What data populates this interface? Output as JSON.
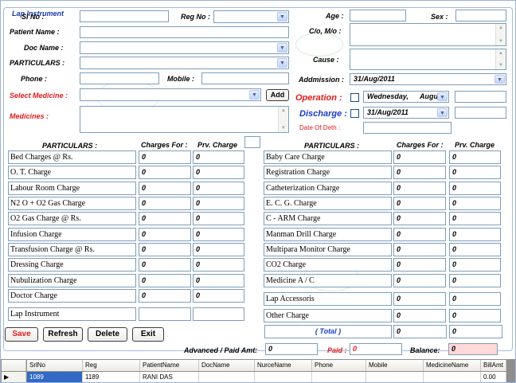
{
  "form": {
    "group_title": "Lap Instrument",
    "sl_no_label": "Sl No :",
    "reg_no_label": "Reg No :",
    "age_label": "Age :",
    "sex_label": "Sex :",
    "patient_name_label": "Patient Name :",
    "co_mo_label": "C/o, M/o :",
    "doc_name_label": "Doc Name :",
    "particulars_label": "PARTICULARS :",
    "cause_label": "Cause :",
    "phone_label": "Phone :",
    "mobile_label": "Mobile :",
    "admission_label": "Addmission :",
    "admission_date": "31/Aug/2011",
    "select_medicine_label": "Select Medicine :",
    "add_button": "Add",
    "operation_label": "Operation :",
    "operation_day": "Wednesday,",
    "operation_month": "Augu",
    "discharge_label": "Discharge :",
    "discharge_date": "31/Aug/2011",
    "date_of_death_label": "Date Of Deth :",
    "medicines_label": "Medicines :"
  },
  "charges": {
    "left_header": "PARTICULARS :",
    "charges_for_header": "Charges For :",
    "prev_charge_header": "Prv. Charge",
    "right_header": "PARTICULARS :",
    "right_charges_for_header": "Charges For :",
    "right_prev_charge_header": "Prv. Charge",
    "left_items": [
      {
        "label": "Bed Charges @ Rs.",
        "charge": "0",
        "prev": "0"
      },
      {
        "label": "O. T. Charge",
        "charge": "0",
        "prev": "0"
      },
      {
        "label": "Labour Room Charge",
        "charge": "0",
        "prev": "0"
      },
      {
        "label": "N2 O + O2  Gas Charge",
        "charge": "0",
        "prev": "0"
      },
      {
        "label": "O2  Gas Charge @ Rs.",
        "charge": "0",
        "prev": "0"
      },
      {
        "label": "Infusion Charge",
        "charge": "0",
        "prev": "0"
      },
      {
        "label": "Transfusion Charge @ Rs.",
        "charge": "0",
        "prev": "0"
      },
      {
        "label": "Dressing Charge",
        "charge": "0",
        "prev": "0"
      },
      {
        "label": "Nubulization Charge",
        "charge": "0",
        "prev": "0"
      },
      {
        "label": "Doctor Charge",
        "charge": "0",
        "prev": "0"
      },
      {
        "label": "Lap Instrument",
        "charge": "",
        "prev": ""
      }
    ],
    "right_items": [
      {
        "label": "Baby Care Charge",
        "charge": "0",
        "prev": "0"
      },
      {
        "label": "Registration Charge",
        "charge": "0",
        "prev": "0"
      },
      {
        "label": "Catheterization Charge",
        "charge": "0",
        "prev": "0"
      },
      {
        "label": "E. C. G. Charge",
        "charge": "0",
        "prev": "0"
      },
      {
        "label": "C - ARM Charge",
        "charge": "0",
        "prev": "0"
      },
      {
        "label": "Manman Drill Charge",
        "charge": "0",
        "prev": "0"
      },
      {
        "label": "Multipara Monitor Charge",
        "charge": "0",
        "prev": "0"
      },
      {
        "label": "CO2  Charge",
        "charge": "0",
        "prev": "0"
      },
      {
        "label": "Medicine A / C",
        "charge": "0",
        "prev": "0"
      },
      {
        "label": "Lap Accessoris",
        "charge": "0",
        "prev": "0"
      },
      {
        "label": "Other Charge",
        "charge": "0",
        "prev": "0"
      }
    ],
    "total_label": "( Total )",
    "total_value": "0",
    "total_prev": "0"
  },
  "buttons": {
    "save": "Save",
    "refresh": "Refresh",
    "delete": "Delete",
    "exit": "Exit"
  },
  "payment": {
    "advanced_label": "Advanced / Paid Amt:",
    "advanced_value": "0",
    "paid_label": "Paid :",
    "paid_value": "0",
    "balance_label": "Balance:",
    "balance_value": "0"
  },
  "grid": {
    "columns": [
      "SrlNo",
      "Reg",
      "PatientName",
      "DocName",
      "NurceName",
      "Phone",
      "Mobile",
      "MedicineName",
      "BillAmt"
    ],
    "row": [
      "1089",
      "1189",
      "RANI DAS",
      "",
      "",
      "",
      "",
      "",
      "0.00"
    ]
  },
  "colors": {
    "accent": "#1a3acb",
    "warning": "#e21a1a",
    "selected_cell": "#316ac5",
    "balance_bg": "#ffd8d8"
  }
}
